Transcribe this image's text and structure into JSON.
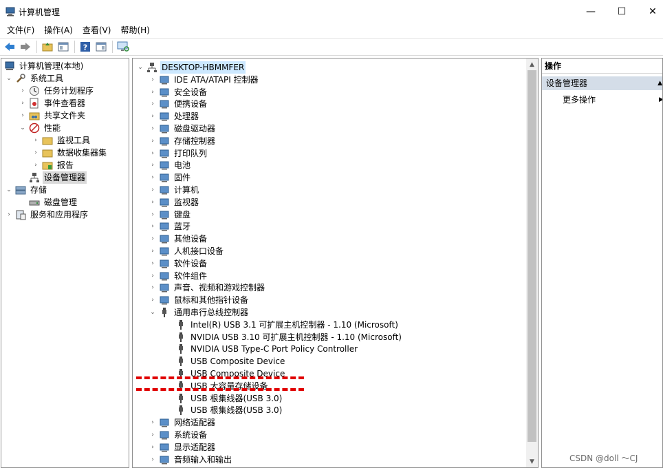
{
  "window": {
    "title": "计算机管理",
    "min": "—",
    "max": "☐",
    "close": "✕"
  },
  "menu": [
    "文件(F)",
    "操作(A)",
    "查看(V)",
    "帮助(H)"
  ],
  "left_tree": [
    {
      "label": "计算机管理(本地)",
      "exp": "",
      "icon": "computer-management-icon"
    },
    {
      "label": "系统工具",
      "exp": "⌄",
      "icon": "system-tools-icon"
    },
    {
      "label": "任务计划程序",
      "exp": "›",
      "icon": "task-scheduler-icon"
    },
    {
      "label": "事件查看器",
      "exp": "›",
      "icon": "event-viewer-icon"
    },
    {
      "label": "共享文件夹",
      "exp": "›",
      "icon": "shared-folders-icon"
    },
    {
      "label": "性能",
      "exp": "⌄",
      "icon": "performance-icon"
    },
    {
      "label": "监视工具",
      "exp": "›",
      "icon": "monitor-tools-icon"
    },
    {
      "label": "数据收集器集",
      "exp": "›",
      "icon": "data-collector-icon"
    },
    {
      "label": "报告",
      "exp": "›",
      "icon": "reports-icon"
    },
    {
      "label": "设备管理器",
      "exp": "",
      "icon": "device-manager-icon"
    },
    {
      "label": "存储",
      "exp": "⌄",
      "icon": "storage-icon"
    },
    {
      "label": "磁盘管理",
      "exp": "",
      "icon": "disk-management-icon"
    },
    {
      "label": "服务和应用程序",
      "exp": "›",
      "icon": "services-icon"
    }
  ],
  "device_tree": {
    "root": "DESKTOP-HBMMFER",
    "categories": [
      "IDE ATA/ATAPI 控制器",
      "安全设备",
      "便携设备",
      "处理器",
      "磁盘驱动器",
      "存储控制器",
      "打印队列",
      "电池",
      "固件",
      "计算机",
      "监视器",
      "键盘",
      "蓝牙",
      "其他设备",
      "人机接口设备",
      "软件设备",
      "软件组件",
      "声音、视频和游戏控制器",
      "鼠标和其他指针设备",
      "通用串行总线控制器"
    ],
    "usb_children": [
      "Intel(R) USB 3.1 可扩展主机控制器 - 1.10 (Microsoft)",
      "NVIDIA USB 3.10 可扩展主机控制器 - 1.10 (Microsoft)",
      "NVIDIA USB Type-C Port Policy Controller",
      "USB Composite Device",
      "USB Composite Device",
      "USB 大容量存储设备",
      "USB 根集线器(USB 3.0)",
      "USB 根集线器(USB 3.0)"
    ],
    "after": [
      "网络适配器",
      "系统设备",
      "显示适配器",
      "音频输入和输出"
    ]
  },
  "actions": {
    "header": "操作",
    "section": "设备管理器",
    "more": "更多操作"
  },
  "watermark": "CSDN @doll ～CJ",
  "colors": {
    "selection_blue": "#cce8ff",
    "annotation_red": "#e00000",
    "actions_section": "#d4dde8"
  }
}
